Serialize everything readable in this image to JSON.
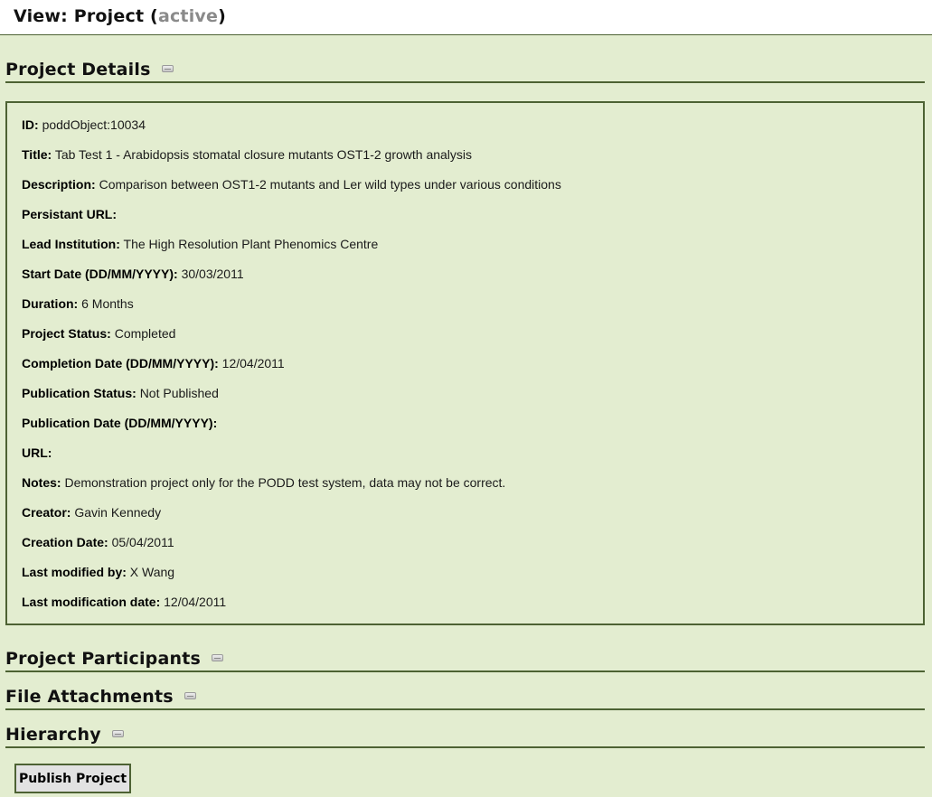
{
  "header": {
    "prefix": "View: Project (",
    "status": "active",
    "suffix": ")"
  },
  "sections": {
    "details": "Project Details",
    "participants": "Project Participants",
    "attachments": "File Attachments",
    "hierarchy": "Hierarchy"
  },
  "fields": [
    {
      "label": "ID:",
      "value": "poddObject:10034"
    },
    {
      "label": "Title:",
      "value": "Tab Test 1 - Arabidopsis stomatal closure mutants OST1-2 growth analysis"
    },
    {
      "label": "Description:",
      "value": "Comparison between OST1-2 mutants and Ler wild types under various conditions"
    },
    {
      "label": "Persistant URL:",
      "value": ""
    },
    {
      "label": "Lead Institution:",
      "value": "The High Resolution Plant Phenomics Centre"
    },
    {
      "label": "Start Date (DD/MM/YYYY):",
      "value": "30/03/2011"
    },
    {
      "label": "Duration:",
      "value": "6 Months"
    },
    {
      "label": "Project Status:",
      "value": "Completed"
    },
    {
      "label": "Completion Date (DD/MM/YYYY):",
      "value": "12/04/2011"
    },
    {
      "label": "Publication Status:",
      "value": "Not Published"
    },
    {
      "label": "Publication Date (DD/MM/YYYY):",
      "value": ""
    },
    {
      "label": "URL:",
      "value": ""
    },
    {
      "label": "Notes:",
      "value": "Demonstration project only for the PODD test system, data may not be correct."
    },
    {
      "label": "Creator:",
      "value": "Gavin Kennedy"
    },
    {
      "label": "Creation Date:",
      "value": "05/04/2011"
    },
    {
      "label": "Last modified by:",
      "value": "X Wang"
    },
    {
      "label": "Last modification date:",
      "value": "12/04/2011"
    }
  ],
  "actions": {
    "publish_label": "Publish Project"
  },
  "icons": {
    "section_toggle": "collapse-toggle-icon"
  },
  "colors": {
    "background": "#e3edd0",
    "rule": "#4d6233",
    "status_text": "#8a8a8a",
    "button_bg": "#e2e2e2"
  }
}
